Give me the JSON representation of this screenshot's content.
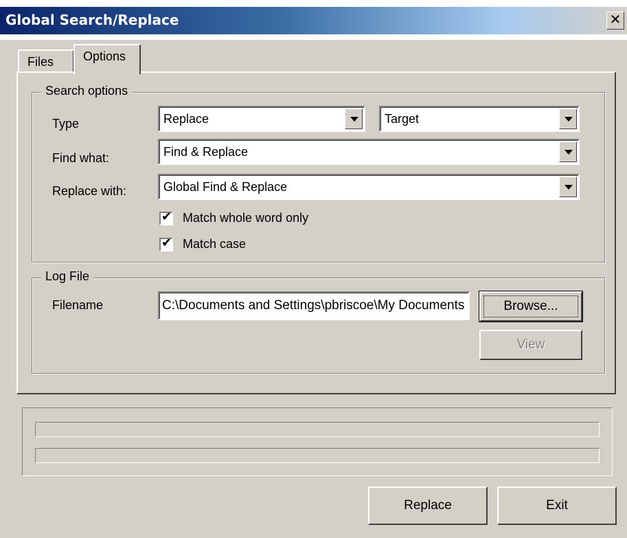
{
  "window": {
    "title": "Global Search/Replace",
    "close_glyph": "✕"
  },
  "tabs": [
    {
      "label": "Files",
      "selected": false
    },
    {
      "label": "Options",
      "selected": true
    }
  ],
  "search_options": {
    "legend": "Search options",
    "type_label": "Type",
    "type_value": "Replace",
    "target_value": "Target",
    "find_label": "Find what:",
    "find_value": "Find & Replace",
    "replace_label": "Replace with:",
    "replace_value": "Global Find & Replace",
    "match_whole_word_label": "Match whole word only",
    "match_whole_word_checked": true,
    "match_case_label": "Match case",
    "match_case_checked": true,
    "check_glyph": "✔"
  },
  "log_file": {
    "legend": "Log File",
    "filename_label": "Filename",
    "filename_value": "C:\\Documents and Settings\\pbriscoe\\My Documents",
    "browse_label": "Browse...",
    "view_label": "View"
  },
  "progress": {
    "bar1_fraction": 0,
    "bar2_fraction": 0
  },
  "buttons": {
    "replace_label": "Replace",
    "exit_label": "Exit"
  },
  "icons": {
    "dropdown": "chevron-down-icon",
    "close": "close-icon"
  }
}
